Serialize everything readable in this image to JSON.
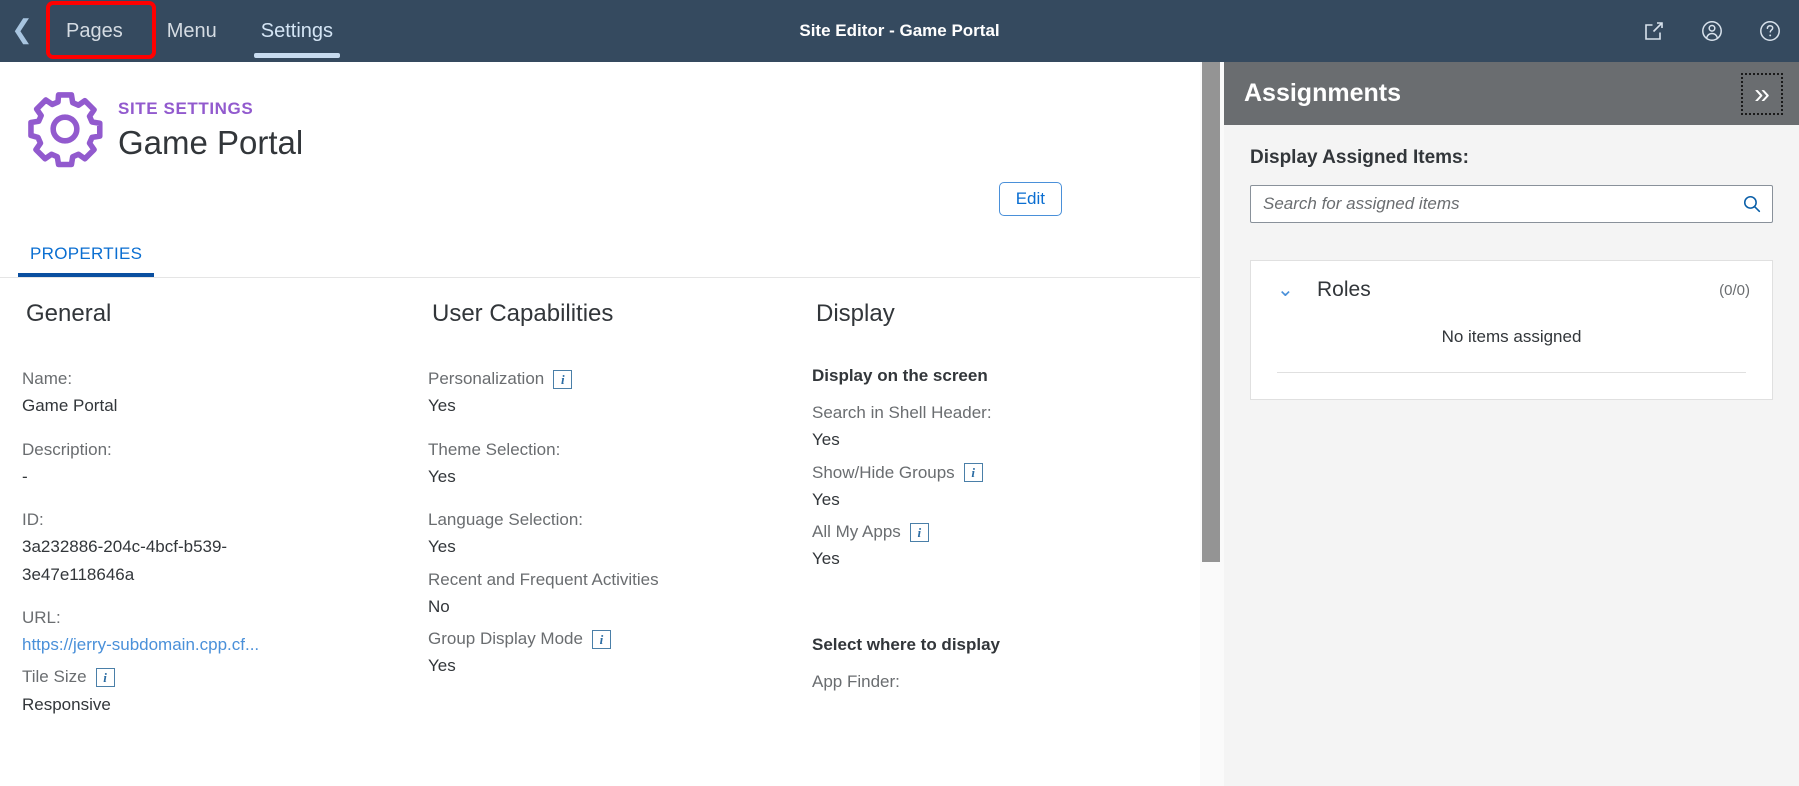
{
  "shell": {
    "back_icon": "chevron-left-icon",
    "tabs": [
      {
        "label": "Pages",
        "active": false,
        "highlighted": true
      },
      {
        "label": "Menu",
        "active": false,
        "highlighted": false
      },
      {
        "label": "Settings",
        "active": true,
        "highlighted": false
      }
    ],
    "title": "Site Editor - Game Portal",
    "actions": [
      {
        "name": "share-icon",
        "label": "Share"
      },
      {
        "name": "user-avatar-icon",
        "label": "User"
      },
      {
        "name": "help-icon",
        "label": "Help"
      }
    ],
    "header_bg": "#354a5f"
  },
  "object_header": {
    "icon": "gear-icon",
    "icon_color": "#925ace",
    "kicker": "SITE SETTINGS",
    "title": "Game Portal",
    "edit_label": "Edit",
    "tabs": [
      {
        "label": "PROPERTIES",
        "active": true
      }
    ]
  },
  "form": {
    "columns": [
      {
        "title": "General",
        "fields": [
          {
            "label": "Name:",
            "value": "Game Portal",
            "info": false,
            "link": false
          },
          {
            "label": "Description:",
            "value": "-",
            "info": false,
            "link": false
          },
          {
            "label": "ID:",
            "value": "3a232886-204c-4bcf-b539-\n3e47e118646a",
            "info": false,
            "link": false
          },
          {
            "label": "URL:",
            "value": "https://jerry-subdomain.cpp.cf...",
            "info": false,
            "link": true
          },
          {
            "label": "Tile Size",
            "value": "Responsive",
            "info": true,
            "link": false
          }
        ]
      },
      {
        "title": "User Capabilities",
        "fields": [
          {
            "label": "Personalization",
            "value": "Yes",
            "info": true,
            "link": false
          },
          {
            "label": "Theme Selection:",
            "value": "Yes",
            "info": false,
            "link": false
          },
          {
            "label": "Language Selection:",
            "value": "Yes",
            "info": false,
            "link": false
          },
          {
            "label": "Recent and Frequent Activities",
            "value": "No",
            "info": false,
            "link": false
          },
          {
            "label": "Group Display Mode",
            "value": "Yes",
            "info": true,
            "link": false
          }
        ]
      },
      {
        "title": "Display",
        "group_one_heading": "Display on the screen",
        "group_one_fields": [
          {
            "label": "Search in Shell Header:",
            "value": "Yes",
            "info": false,
            "link": false
          },
          {
            "label": "Show/Hide Groups",
            "value": "Yes",
            "info": true,
            "link": false
          },
          {
            "label": "All My Apps",
            "value": "Yes",
            "info": true,
            "link": false
          }
        ],
        "group_two_heading": "Select where to display",
        "group_two_fields": [
          {
            "label": "App Finder:",
            "value": "",
            "info": false,
            "link": false
          }
        ]
      }
    ]
  },
  "panel": {
    "title": "Assignments",
    "collapse_icon": "double-chevron-right-icon",
    "section_label": "Display Assigned Items:",
    "search": {
      "value": "",
      "placeholder": "Search for assigned items",
      "icon": "search-icon"
    },
    "card": {
      "expand_icon": "chevron-down-icon",
      "title": "Roles",
      "count": "(0/0)",
      "empty_text": "No items assigned"
    }
  }
}
